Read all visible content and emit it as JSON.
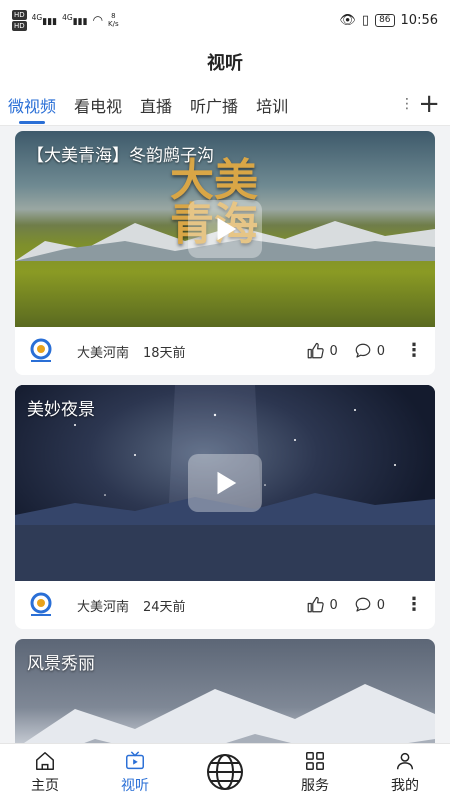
{
  "status_bar": {
    "hd1": "HD",
    "hd2": "HD",
    "signal1": "4G",
    "signal2": "4G",
    "speed_value": "8",
    "speed_unit": "K/s",
    "battery": "86",
    "time": "10:56"
  },
  "header": {
    "title": "视听"
  },
  "tabs": [
    {
      "label": "微视频",
      "active": true
    },
    {
      "label": "看电视",
      "active": false
    },
    {
      "label": "直播",
      "active": false
    },
    {
      "label": "听广播",
      "active": false
    },
    {
      "label": "培训",
      "active": false
    }
  ],
  "feed": [
    {
      "title": "【大美青海】冬韵鹧子沟",
      "overlay_text": "大美\n青海",
      "author": "大美河南",
      "time": "18天前",
      "likes": "0",
      "comments": "0"
    },
    {
      "title": "美妙夜景",
      "author": "大美河南",
      "time": "24天前",
      "likes": "0",
      "comments": "0"
    },
    {
      "title": "风景秀丽"
    }
  ],
  "bottom_nav": [
    {
      "label": "主页",
      "icon": "home-icon",
      "active": false
    },
    {
      "label": "视听",
      "icon": "video-icon",
      "active": true
    },
    {
      "label": "",
      "icon": "globe-icon",
      "active": false
    },
    {
      "label": "服务",
      "icon": "grid-icon",
      "active": false
    },
    {
      "label": "我的",
      "icon": "person-icon",
      "active": false
    }
  ],
  "colors": {
    "accent": "#2a6fd6",
    "background": "#f2f3f5"
  }
}
